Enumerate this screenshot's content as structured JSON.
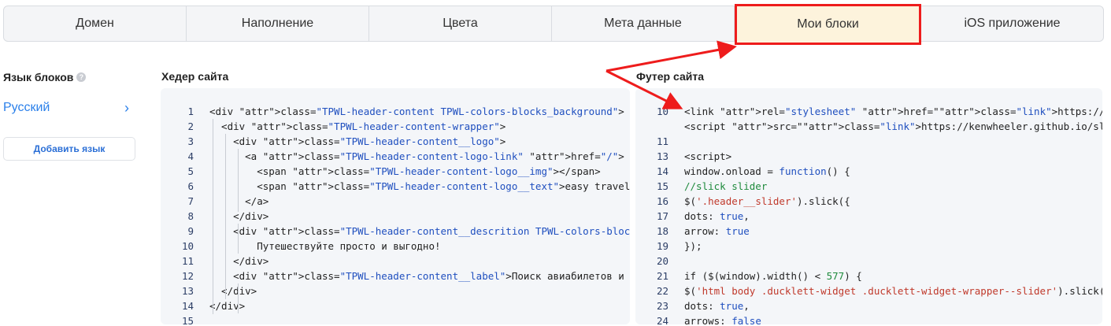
{
  "tabs": [
    {
      "label": "Домен"
    },
    {
      "label": "Наполнение"
    },
    {
      "label": "Цвета"
    },
    {
      "label": "Мета данные"
    },
    {
      "label": "Мои блоки"
    },
    {
      "label": "iOS приложение"
    }
  ],
  "active_tab": "Мои блоки",
  "sidebar": {
    "title": "Язык блоков",
    "help_glyph": "?",
    "language": "Русский",
    "add_language_button": "Добавить язык"
  },
  "header_section": {
    "title": "Хедер сайта",
    "lines": [
      {
        "n": "1",
        "code": "<div class=\"TPWL-header-content TPWL-colors-blocks_background\">"
      },
      {
        "n": "2",
        "code": "  <div class=\"TPWL-header-content-wrapper\">"
      },
      {
        "n": "3",
        "code": "    <div class=\"TPWL-header-content__logo\">"
      },
      {
        "n": "4",
        "code": "      <a class=\"TPWL-header-content-logo-link\" href=\"/\">"
      },
      {
        "n": "5",
        "code": "        <span class=\"TPWL-header-content-logo__img\"></span>"
      },
      {
        "n": "6",
        "code": "        <span class=\"TPWL-header-content-logo__text\">easy travel</span>"
      },
      {
        "n": "7",
        "code": "      </a>"
      },
      {
        "n": "8",
        "code": "    </div>"
      },
      {
        "n": "9",
        "code": "    <div class=\"TPWL-header-content__descrition TPWL-colors-blocks_text\">"
      },
      {
        "n": "10",
        "code": "        Путешествуйте просто и выгодно!"
      },
      {
        "n": "11",
        "code": "    </div>"
      },
      {
        "n": "12",
        "code": "    <div class=\"TPWL-header-content__label\">Поиск авиабилетов и отелей</div>"
      },
      {
        "n": "13",
        "code": "  </div>"
      },
      {
        "n": "14",
        "code": "</div>"
      },
      {
        "n": "15",
        "code": ""
      }
    ]
  },
  "footer_section": {
    "title": "Футер сайта",
    "lines": [
      {
        "n": "10",
        "code": "<link rel=\"stylesheet\" href=\"https://cdnjs.cloudflare.com/ajax/libs/slick-carousel\">"
      },
      {
        "n": "",
        "code": "<script src=\"https://kenwheeler.github.io/slick/slick/slick.js\" crossorigin>"
      },
      {
        "n": "11",
        "code": ""
      },
      {
        "n": "13",
        "code": "<script>"
      },
      {
        "n": "14",
        "code": "window.onload = function() {"
      },
      {
        "n": "15",
        "code": "//slick slider"
      },
      {
        "n": "16",
        "code": "$('.header__slider').slick({"
      },
      {
        "n": "17",
        "code": "dots: true,"
      },
      {
        "n": "18",
        "code": "arrow: true"
      },
      {
        "n": "19",
        "code": "});"
      },
      {
        "n": "20",
        "code": ""
      },
      {
        "n": "21",
        "code": "if ($(window).width() < 577) {"
      },
      {
        "n": "22",
        "code": "$('html body .ducklett-widget .ducklett-widget-wrapper--slider').slick({"
      },
      {
        "n": "23",
        "code": "dots: true,"
      },
      {
        "n": "24",
        "code": "arrows: false"
      }
    ]
  },
  "colors": {
    "accent_red": "#ee1c1c",
    "active_tab_bg": "#fdf3dc",
    "link_blue": "#2b80ea"
  }
}
